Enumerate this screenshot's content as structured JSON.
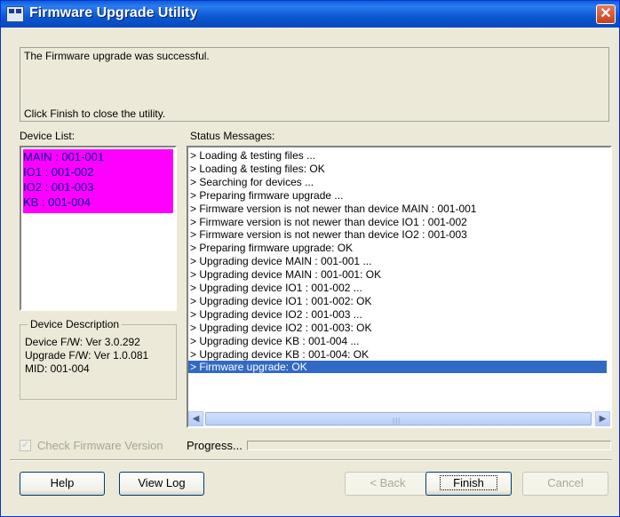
{
  "window": {
    "title": "Firmware Upgrade Utility",
    "close_glyph": "✕"
  },
  "message": {
    "line1": "The Firmware upgrade was successful.",
    "line2": "Click Finish to close the utility."
  },
  "device_list": {
    "label": "Device List:",
    "items": [
      "MAIN : 001-001",
      "IO1 : 001-002",
      "IO2 : 001-003",
      "KB : 001-004"
    ],
    "highlight_color": "#ff00ff",
    "text_color": "#00008b"
  },
  "device_description": {
    "title": "Device Description",
    "lines": [
      "Device F/W: Ver 3.0.292",
      "Upgrade F/W: Ver 1.0.081",
      "MID: 001-004"
    ]
  },
  "status": {
    "label": "Status Messages:",
    "lines": [
      "> Loading & testing files ...",
      "> Loading & testing files: OK",
      "> Searching for devices ...",
      "> Preparing firmware upgrade ...",
      "> Firmware version is not newer than device MAIN : 001-001",
      "> Firmware version is not newer than device IO1 : 001-002",
      "> Firmware version is not newer than device IO2 : 001-003",
      "> Preparing firmware upgrade: OK",
      "> Upgrading device MAIN : 001-001 ...",
      "> Upgrading device MAIN : 001-001: OK",
      "> Upgrading device IO1 : 001-002 ...",
      "> Upgrading device IO1 : 001-002: OK",
      "> Upgrading device IO2 : 001-003 ...",
      "> Upgrading device IO2 : 001-003: OK",
      "> Upgrading device KB : 001-004 ...",
      "> Upgrading device KB : 001-004: OK",
      "> Firmware upgrade: OK"
    ],
    "selected_index": 16,
    "selection_color": "#316ac5"
  },
  "options": {
    "check_firmware_label": "Check Firmware Version",
    "check_firmware_checked": true,
    "check_firmware_enabled": false
  },
  "progress": {
    "label": "Progress...",
    "value": 0
  },
  "buttons": {
    "help": "Help",
    "view_log": "View Log",
    "back": "< Back",
    "finish": "Finish",
    "cancel": "Cancel"
  }
}
